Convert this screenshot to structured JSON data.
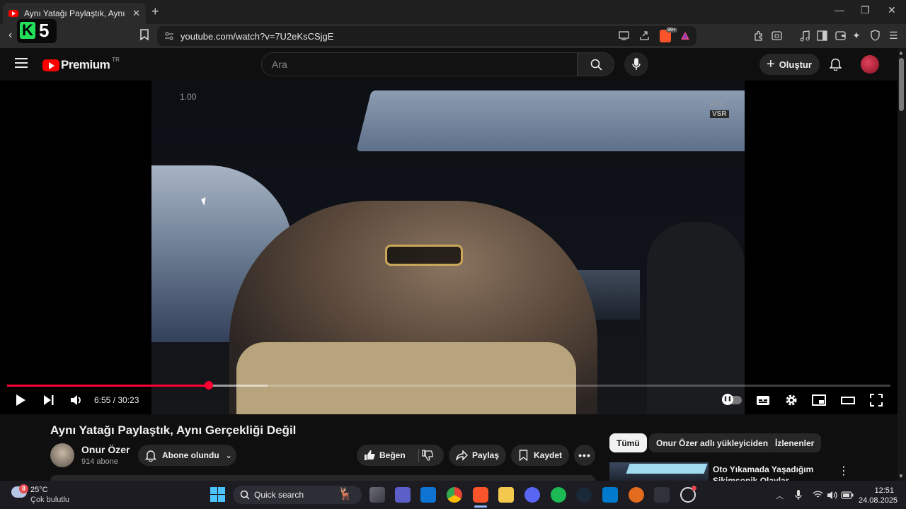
{
  "browser": {
    "tab_title": "Aynı Yatağı Paylaştık, Aynı Gerçekliği Değil",
    "url": "youtube.com/watch?v=7U2eKsCSjgE",
    "badge_count": "99+",
    "overlay_logo": {
      "letter": "K",
      "number": "5"
    }
  },
  "youtube": {
    "logo_text": "Premium",
    "logo_region": "TR",
    "search_placeholder": "Ara",
    "create_label": "Oluştur"
  },
  "player": {
    "speed_label": "1.00",
    "rtx_line1": "RTX",
    "rtx_line2": "VSR",
    "current_time": "6:55",
    "duration": "30:23",
    "timecode": "6:55 / 30:23",
    "progress": {
      "played_fraction": 0.228,
      "buffered_fraction": 0.295
    }
  },
  "video": {
    "title": "Aynı Yatağı Paylaştık, Aynı Gerçekliği Değil",
    "channel_name": "Onur Özer",
    "subscribers": "914 abone",
    "subscribe_label": "Abone olundu",
    "like_label": "Beğen",
    "share_label": "Paylaş",
    "save_label": "Kaydet"
  },
  "recommendations": {
    "chips": [
      "Tümü",
      "Onur Özer adlı yükleyiciden",
      "İzlenenler"
    ],
    "first_title": "Oto Yıkamada Yaşadığım Sikimsonik Olaylar"
  },
  "taskbar": {
    "weather_badge": "8",
    "temperature": "25°C",
    "weather_desc": "Çok bulutlu",
    "search_label": "Quick search",
    "time": "12:51",
    "date": "24.08.2025"
  },
  "colors": {
    "accent": "#ff0033",
    "yt_red": "#ff0000",
    "bg": "#0f0f0f"
  }
}
